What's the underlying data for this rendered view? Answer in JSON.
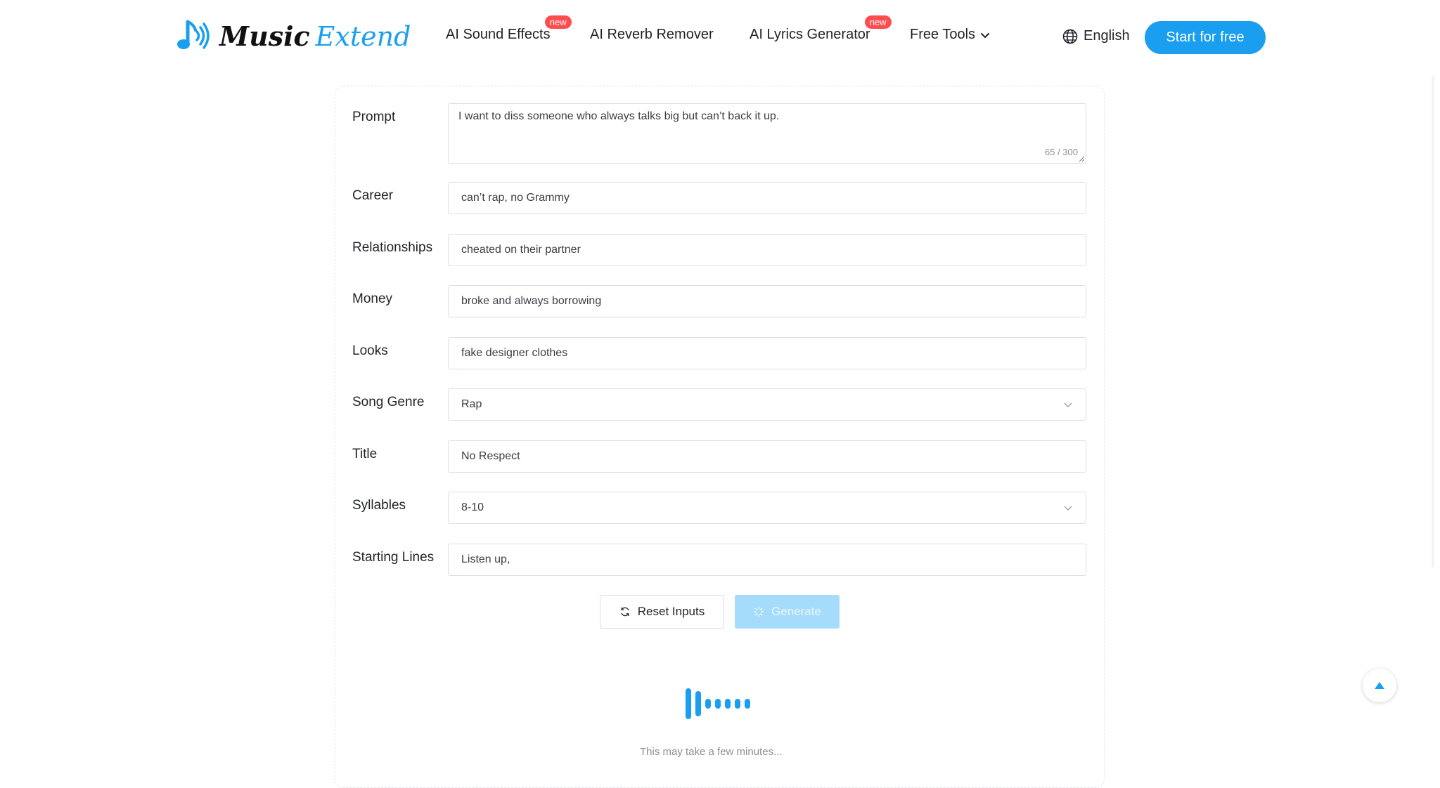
{
  "brand": {
    "word1": "Music",
    "word2": "Extend",
    "accent": "#1a9ef0"
  },
  "nav": {
    "items": [
      {
        "label": "AI Sound Effects",
        "badge": "new"
      },
      {
        "label": "AI Reverb Remover",
        "badge": ""
      },
      {
        "label": "AI Lyrics Generator",
        "badge": "new"
      },
      {
        "label": "Free Tools",
        "badge": ""
      }
    ],
    "language": "English",
    "cta": "Start for free"
  },
  "form": {
    "prompt": {
      "label": "Prompt",
      "value": "I want to diss someone who always talks big but can’t back it up.",
      "counter": "65 / 300"
    },
    "career": {
      "label": "Career",
      "value": "can’t rap, no Grammy"
    },
    "relationships": {
      "label": "Relationships",
      "value": "cheated on their partner"
    },
    "money": {
      "label": "Money",
      "value": "broke and always borrowing"
    },
    "looks": {
      "label": "Looks",
      "value": "fake designer clothes"
    },
    "genre": {
      "label": "Song Genre",
      "value": "Rap"
    },
    "title": {
      "label": "Title",
      "value": "No Respect"
    },
    "syllables": {
      "label": "Syllables",
      "value": "8-10"
    },
    "starting_lines": {
      "label": "Starting Lines",
      "value": "Listen up,"
    }
  },
  "actions": {
    "reset": "Reset Inputs",
    "generate": "Generate"
  },
  "status": {
    "note": "This may take a few minutes..."
  },
  "icons": [
    "music-note-logo-icon",
    "globe-icon",
    "chevron-down-icon",
    "refresh-icon",
    "spinner-icon",
    "audio-wave-loader-icon",
    "arrow-up-icon"
  ]
}
